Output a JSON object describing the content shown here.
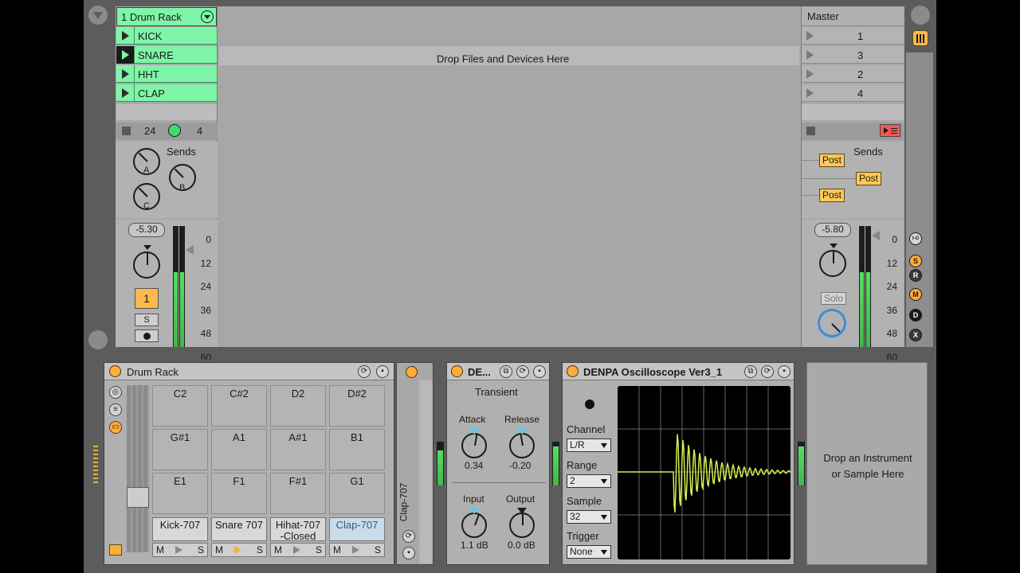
{
  "track": {
    "name": "1 Drum Rack",
    "clips": [
      "KICK",
      "SNARE",
      "HHT",
      "CLAP"
    ],
    "playing_clip": 1,
    "io_left": "24",
    "io_right": "4",
    "sends_label": "Sends",
    "send_a": "A",
    "send_b": "B",
    "send_c": "C",
    "volume": "-5.30",
    "number": "1",
    "solo": "S",
    "meter_ticks": [
      "0",
      "12",
      "24",
      "36",
      "48",
      "60"
    ],
    "meter_level_l": 0.62,
    "meter_level_r": 0.62
  },
  "arrangement": {
    "drop_hint": "Drop Files and Devices Here"
  },
  "master": {
    "name": "Master",
    "scenes": [
      "1",
      "3",
      "2",
      "4"
    ],
    "sends_label": "Sends",
    "post_labels": [
      "Post",
      "Post",
      "Post"
    ],
    "volume": "-5.80",
    "solo": "Solo",
    "meter_ticks": [
      "0",
      "12",
      "24",
      "36",
      "48",
      "60"
    ],
    "meter_level": 0.62
  },
  "side_icons": [
    "I-O",
    "S",
    "R",
    "M",
    "D",
    "X"
  ],
  "drum_rack": {
    "title": "Drum Rack",
    "pads_top": [
      "C2",
      "C#2",
      "D2",
      "D#2",
      "G#1",
      "A1",
      "A#1",
      "B1",
      "E1",
      "F1",
      "F#1",
      "G1"
    ],
    "named_pads": [
      "Kick-707",
      "Snare 707",
      "Hihat-707\n-Closed",
      "Clap-707"
    ],
    "pad_m": "M",
    "pad_s": "S",
    "chain_name": "Clap-707"
  },
  "transient": {
    "title": "DE...",
    "subtitle": "Transient",
    "attack_label": "Attack",
    "attack_value": "0.34",
    "release_label": "Release",
    "release_value": "-0.20",
    "input_label": "Input",
    "input_value": "1.1 dB",
    "output_label": "Output",
    "output_value": "0.0 dB"
  },
  "oscilloscope": {
    "title": "DENPA Oscilloscope Ver3_1",
    "channel_label": "Channel",
    "channel_value": "L/R",
    "range_label": "Range",
    "range_value": "2",
    "sample_label": "Sample",
    "sample_value": "32",
    "trigger_label": "Trigger",
    "trigger_value": "None"
  },
  "drop_instrument": "Drop an Instrument\nor Sample Here",
  "colors": {
    "clip_green": "#7ef5a7",
    "accent_orange": "#ffad3b",
    "scope_trace": "#d4f04a",
    "meter_green": "#54e05f"
  }
}
